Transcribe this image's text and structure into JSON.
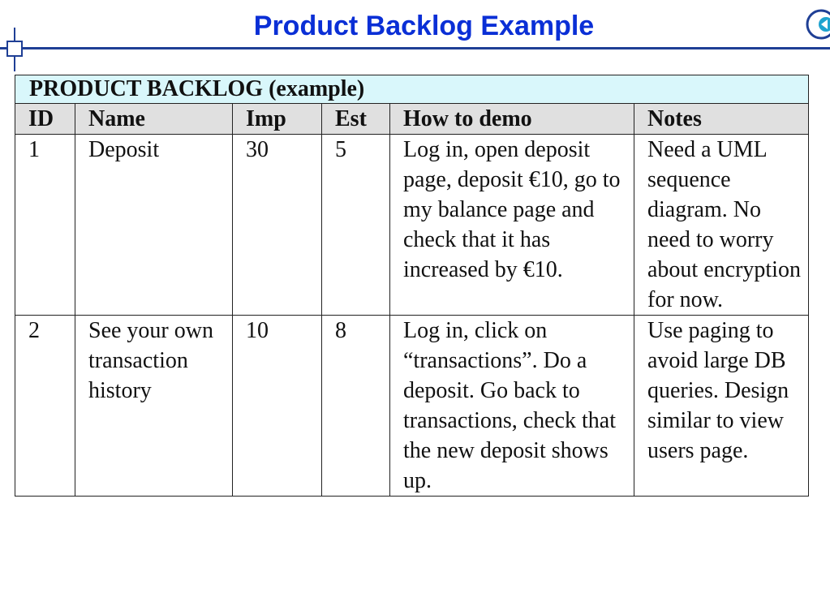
{
  "slide": {
    "title": "Product Backlog Example"
  },
  "table": {
    "banner": "PRODUCT BACKLOG (example)",
    "headers": [
      "ID",
      "Name",
      "Imp",
      "Est",
      "How to demo",
      "Notes"
    ],
    "rows": [
      {
        "id": "1",
        "name": "Deposit",
        "imp": "30",
        "est": "5",
        "how_to_demo": "Log in, open deposit page, deposit €10, go to my balance page and check that it has increased by €10.",
        "notes": "Need a UML sequence diagram.  No need to worry about encryption for now."
      },
      {
        "id": "2",
        "name": "See your own transaction history",
        "imp": "10",
        "est": "8",
        "how_to_demo": "Log in, click on “transactions”. Do a deposit. Go back to transactions, check that the new deposit shows up.",
        "notes": "Use paging to avoid large DB queries. Design similar to view users page."
      }
    ]
  },
  "icons": {
    "back": "arrow-left-circle-icon",
    "corner": "crosshair-icon"
  },
  "colors": {
    "title": "#0a2fd6",
    "rule": "#1f3f95",
    "banner_bg": "#d9f7fb",
    "header_bg": "#e0e0e0"
  }
}
